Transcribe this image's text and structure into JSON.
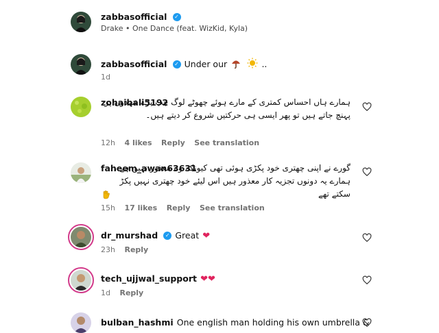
{
  "post": {
    "username": "zabbasofficial",
    "music": "Drake • One Dance (feat. WizKid, Kyla)"
  },
  "caption": {
    "username": "zabbasofficial",
    "text": "Under our",
    "suffix": "..",
    "time": "1d"
  },
  "comments": [
    {
      "username": "zohaibali5192",
      "text": "ہمارے ہاں احساس کمتری کے مارے ہوئے چھوٹے لوگ جب بڑے عہدوں پر پہنچ جاتے ہیں تو پھر ایسی ہی حرکتیں شروع کر دیتے ہیں۔",
      "time": "12h",
      "likes": "4 likes",
      "reply": "Reply",
      "translate": "See translation"
    },
    {
      "username": "faheem_awan63631",
      "text": "گورے نے اپنی چھتری خود پکڑی ہوئی تھی کیونکہ وہ معذور نہیں ہے ، ہمارے یہ دونوں تجزیہ کار معذور ہیں اس لیئے خود چھتری نہیں پکڑ سکتے تھے",
      "time": "15h",
      "likes": "17 likes",
      "reply": "Reply",
      "translate": "See translation"
    },
    {
      "username": "dr_murshad",
      "text": "Great",
      "time": "23h",
      "reply": "Reply"
    },
    {
      "username": "tech_ujjwal_support",
      "time": "1d",
      "reply": "Reply"
    },
    {
      "username": "bulban_hashmi",
      "text": "One english man holding his own umbrella &"
    }
  ],
  "colors": {
    "verified": "#1d9bf0",
    "heart": "#e0245e",
    "story_ring": "#d23a8a",
    "meta": "#737373"
  },
  "icons": [
    "verified-icon",
    "heart-outline-icon",
    "red-heart-icon",
    "umbrella-icon",
    "sun-icon",
    "waving-hand-icon"
  ]
}
